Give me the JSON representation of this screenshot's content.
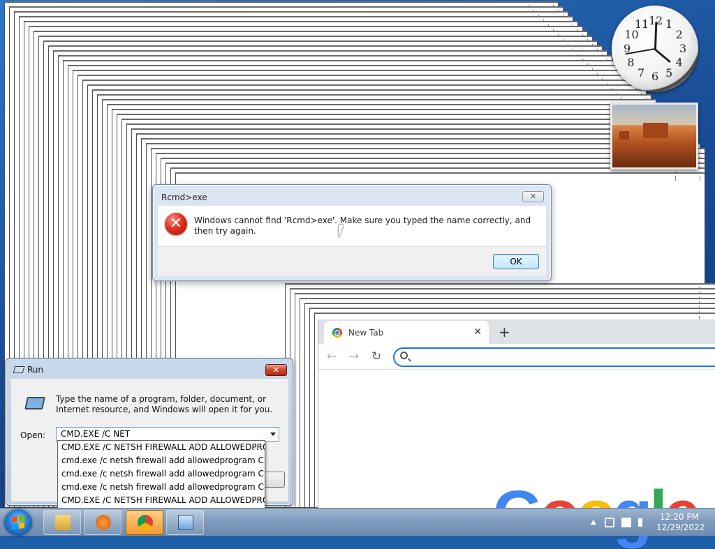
{
  "gadgets": {
    "clock_numbers": [
      "12",
      "1",
      "2",
      "3",
      "4",
      "5",
      "6",
      "7",
      "8",
      "9",
      "10",
      "11"
    ]
  },
  "error_dialog": {
    "title": "Rcmd>exe",
    "close_label": "✕",
    "message": "Windows cannot find 'Rcmd>exe'. Make sure you typed the name correctly, and then try again.",
    "ok_label": "OK"
  },
  "chrome": {
    "tab_title": "New Tab",
    "tab_close": "✕",
    "new_tab": "+",
    "back": "←",
    "forward": "→",
    "reload": "↻",
    "logo_letters": [
      {
        "ch": "G",
        "color": "#4285F4"
      },
      {
        "ch": "o",
        "color": "#EA4335"
      },
      {
        "ch": "o",
        "color": "#FBBC05"
      },
      {
        "ch": "g",
        "color": "#4285F4"
      },
      {
        "ch": "l",
        "color": "#34A853"
      },
      {
        "ch": "e",
        "color": "#EA4335"
      }
    ]
  },
  "run_dialog": {
    "title": "Run",
    "close_label": "✕",
    "description": "Type the name of a program, folder, document, or Internet resource, and Windows will open it for you.",
    "open_label": "Open:",
    "open_value": "CMD.EXE /C NET",
    "autocomplete": [
      "CMD.EXE /C NETSH FIREWALL ADD ALLOWEDPROGRA",
      "cmd.exe /c netsh firewall add allowedprogram C:\\Wind",
      "cmd.exe /c netsh firewall add allowedprogram C:\\Wind",
      "cmd.exe /c netsh firewall add allowedprogram C:\\Wind",
      "CMD.EXE /C NETSH FIREWALL ADD ALLOWEDPROGRA"
    ]
  },
  "taskbar": {
    "items": [
      "explorer-icon",
      "media-player-icon",
      "chrome-icon",
      "run-icon"
    ],
    "tray_icons": [
      "show-hidden-icon",
      "network-icon",
      "action-center-icon",
      "volume-icon"
    ],
    "show_hidden": "▲",
    "time": "12:20 PM",
    "date": "12/29/2022"
  }
}
